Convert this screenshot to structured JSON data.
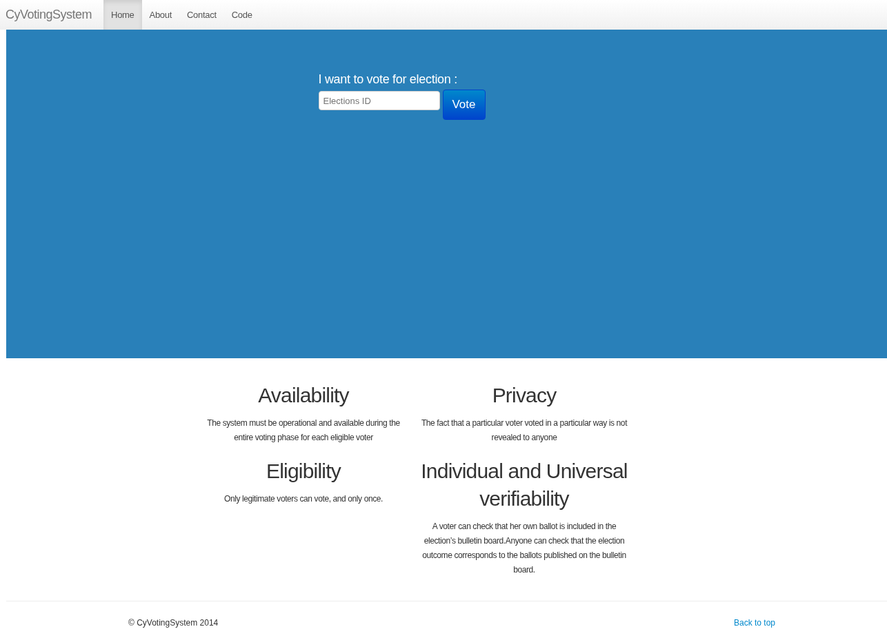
{
  "navbar": {
    "brand": "CyVotingSystem",
    "items": [
      {
        "label": "Home",
        "selected": true
      },
      {
        "label": "About",
        "selected": false
      },
      {
        "label": "Contact",
        "selected": false
      },
      {
        "label": "Code",
        "selected": false
      }
    ]
  },
  "hero": {
    "label": "I want to vote for election :",
    "input": {
      "placeholder": "Elections ID"
    },
    "button": "Vote"
  },
  "features": [
    {
      "title": "Availability",
      "text": "The system must be operational and available during the entire voting phase for each eligible voter"
    },
    {
      "title": "Privacy",
      "text": "The fact that a particular voter voted in a particular way is not revealed to anyone"
    },
    {
      "title": "Eligibility",
      "text": "Only legitimate voters can vote, and only once."
    },
    {
      "title": "Individual and Universal verifiability",
      "text": "A voter can check that her own ballot is included in the election’s bulletin board.Anyone can check that the election outcome corresponds to the ballots published on the bulletin board."
    }
  ],
  "footer": {
    "copyright": "© CyVotingSystem 2014",
    "back_to_top": "Back to top"
  }
}
